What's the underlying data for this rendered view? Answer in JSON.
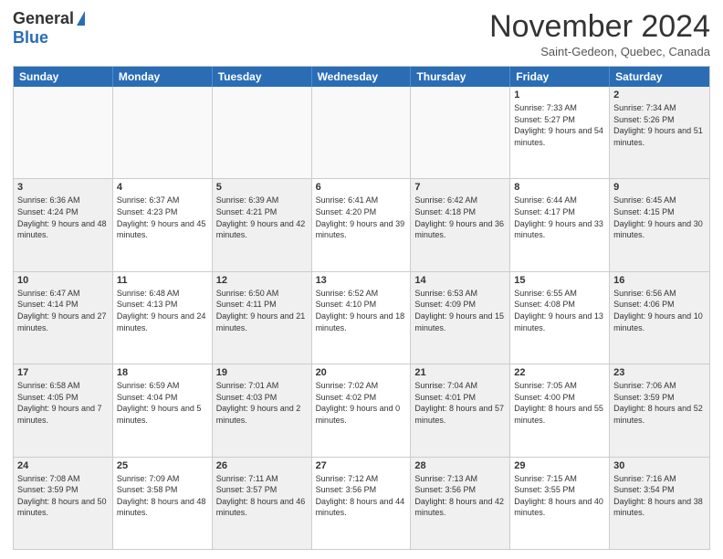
{
  "logo": {
    "line1": "General",
    "line2": "Blue"
  },
  "title": "November 2024",
  "subtitle": "Saint-Gedeon, Quebec, Canada",
  "headers": [
    "Sunday",
    "Monday",
    "Tuesday",
    "Wednesday",
    "Thursday",
    "Friday",
    "Saturday"
  ],
  "rows": [
    [
      {
        "day": "",
        "info": "",
        "empty": true
      },
      {
        "day": "",
        "info": "",
        "empty": true
      },
      {
        "day": "",
        "info": "",
        "empty": true
      },
      {
        "day": "",
        "info": "",
        "empty": true
      },
      {
        "day": "",
        "info": "",
        "empty": true
      },
      {
        "day": "1",
        "info": "Sunrise: 7:33 AM\nSunset: 5:27 PM\nDaylight: 9 hours and 54 minutes."
      },
      {
        "day": "2",
        "info": "Sunrise: 7:34 AM\nSunset: 5:26 PM\nDaylight: 9 hours and 51 minutes.",
        "shaded": true
      }
    ],
    [
      {
        "day": "3",
        "info": "Sunrise: 6:36 AM\nSunset: 4:24 PM\nDaylight: 9 hours and 48 minutes.",
        "shaded": true
      },
      {
        "day": "4",
        "info": "Sunrise: 6:37 AM\nSunset: 4:23 PM\nDaylight: 9 hours and 45 minutes."
      },
      {
        "day": "5",
        "info": "Sunrise: 6:39 AM\nSunset: 4:21 PM\nDaylight: 9 hours and 42 minutes.",
        "shaded": true
      },
      {
        "day": "6",
        "info": "Sunrise: 6:41 AM\nSunset: 4:20 PM\nDaylight: 9 hours and 39 minutes."
      },
      {
        "day": "7",
        "info": "Sunrise: 6:42 AM\nSunset: 4:18 PM\nDaylight: 9 hours and 36 minutes.",
        "shaded": true
      },
      {
        "day": "8",
        "info": "Sunrise: 6:44 AM\nSunset: 4:17 PM\nDaylight: 9 hours and 33 minutes."
      },
      {
        "day": "9",
        "info": "Sunrise: 6:45 AM\nSunset: 4:15 PM\nDaylight: 9 hours and 30 minutes.",
        "shaded": true
      }
    ],
    [
      {
        "day": "10",
        "info": "Sunrise: 6:47 AM\nSunset: 4:14 PM\nDaylight: 9 hours and 27 minutes.",
        "shaded": true
      },
      {
        "day": "11",
        "info": "Sunrise: 6:48 AM\nSunset: 4:13 PM\nDaylight: 9 hours and 24 minutes."
      },
      {
        "day": "12",
        "info": "Sunrise: 6:50 AM\nSunset: 4:11 PM\nDaylight: 9 hours and 21 minutes.",
        "shaded": true
      },
      {
        "day": "13",
        "info": "Sunrise: 6:52 AM\nSunset: 4:10 PM\nDaylight: 9 hours and 18 minutes."
      },
      {
        "day": "14",
        "info": "Sunrise: 6:53 AM\nSunset: 4:09 PM\nDaylight: 9 hours and 15 minutes.",
        "shaded": true
      },
      {
        "day": "15",
        "info": "Sunrise: 6:55 AM\nSunset: 4:08 PM\nDaylight: 9 hours and 13 minutes."
      },
      {
        "day": "16",
        "info": "Sunrise: 6:56 AM\nSunset: 4:06 PM\nDaylight: 9 hours and 10 minutes.",
        "shaded": true
      }
    ],
    [
      {
        "day": "17",
        "info": "Sunrise: 6:58 AM\nSunset: 4:05 PM\nDaylight: 9 hours and 7 minutes.",
        "shaded": true
      },
      {
        "day": "18",
        "info": "Sunrise: 6:59 AM\nSunset: 4:04 PM\nDaylight: 9 hours and 5 minutes."
      },
      {
        "day": "19",
        "info": "Sunrise: 7:01 AM\nSunset: 4:03 PM\nDaylight: 9 hours and 2 minutes.",
        "shaded": true
      },
      {
        "day": "20",
        "info": "Sunrise: 7:02 AM\nSunset: 4:02 PM\nDaylight: 9 hours and 0 minutes."
      },
      {
        "day": "21",
        "info": "Sunrise: 7:04 AM\nSunset: 4:01 PM\nDaylight: 8 hours and 57 minutes.",
        "shaded": true
      },
      {
        "day": "22",
        "info": "Sunrise: 7:05 AM\nSunset: 4:00 PM\nDaylight: 8 hours and 55 minutes."
      },
      {
        "day": "23",
        "info": "Sunrise: 7:06 AM\nSunset: 3:59 PM\nDaylight: 8 hours and 52 minutes.",
        "shaded": true
      }
    ],
    [
      {
        "day": "24",
        "info": "Sunrise: 7:08 AM\nSunset: 3:59 PM\nDaylight: 8 hours and 50 minutes.",
        "shaded": true
      },
      {
        "day": "25",
        "info": "Sunrise: 7:09 AM\nSunset: 3:58 PM\nDaylight: 8 hours and 48 minutes."
      },
      {
        "day": "26",
        "info": "Sunrise: 7:11 AM\nSunset: 3:57 PM\nDaylight: 8 hours and 46 minutes.",
        "shaded": true
      },
      {
        "day": "27",
        "info": "Sunrise: 7:12 AM\nSunset: 3:56 PM\nDaylight: 8 hours and 44 minutes."
      },
      {
        "day": "28",
        "info": "Sunrise: 7:13 AM\nSunset: 3:56 PM\nDaylight: 8 hours and 42 minutes.",
        "shaded": true
      },
      {
        "day": "29",
        "info": "Sunrise: 7:15 AM\nSunset: 3:55 PM\nDaylight: 8 hours and 40 minutes."
      },
      {
        "day": "30",
        "info": "Sunrise: 7:16 AM\nSunset: 3:54 PM\nDaylight: 8 hours and 38 minutes.",
        "shaded": true
      }
    ]
  ]
}
